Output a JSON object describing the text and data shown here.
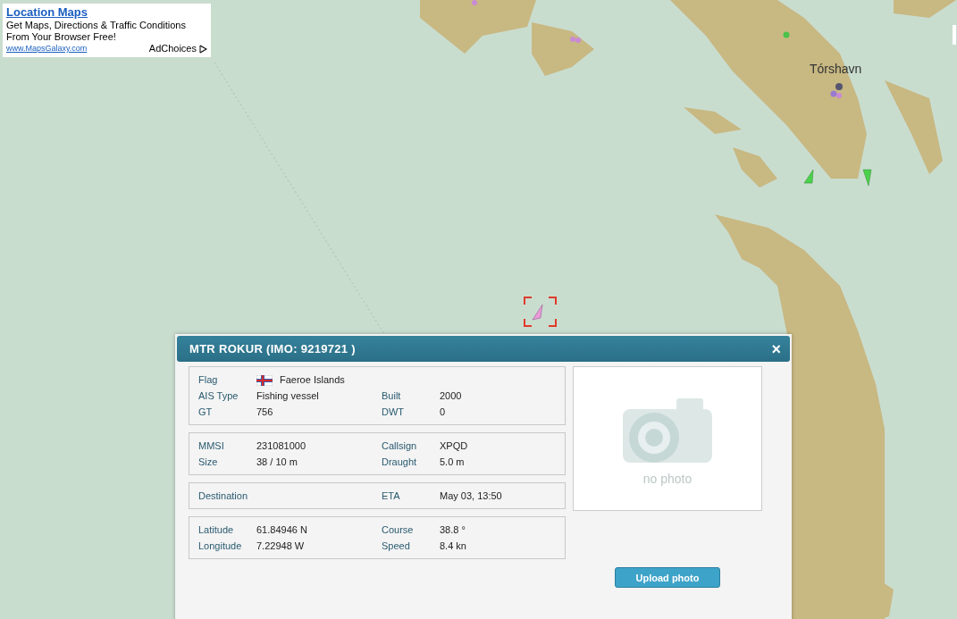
{
  "ad": {
    "title": "Location Maps",
    "lines": [
      "Get Maps, Directions & Traffic Conditions",
      "From Your Browser Free!"
    ],
    "url": "www.MapsGalaxy.com",
    "choices": "AdChoices"
  },
  "map": {
    "place_label": "Tórshavn"
  },
  "popup": {
    "title": "MTR ROKUR (IMO: 9219721 )",
    "close": "×",
    "sections": [
      {
        "rows": [
          {
            "fields": [
              {
                "label": "Flag",
                "value": "Faeroe Islands",
                "kind": "flag"
              }
            ]
          },
          {
            "fields": [
              {
                "label": "AIS Type",
                "value": "Fishing vessel"
              },
              {
                "label": "Built",
                "value": "2000"
              }
            ]
          },
          {
            "fields": [
              {
                "label": "GT",
                "value": "756"
              },
              {
                "label": "DWT",
                "value": "0"
              }
            ]
          }
        ]
      },
      {
        "rows": [
          {
            "fields": [
              {
                "label": "MMSI",
                "value": "231081000"
              },
              {
                "label": "Callsign",
                "value": "XPQD"
              }
            ]
          },
          {
            "fields": [
              {
                "label": "Size",
                "value": "38 / 10 m"
              },
              {
                "label": "Draught",
                "value": "5.0 m"
              }
            ]
          }
        ]
      },
      {
        "rows": [
          {
            "fields": [
              {
                "label": "Destination"
              },
              {
                "label": "ETA",
                "value": "May 03, 13:50"
              }
            ]
          }
        ]
      },
      {
        "rows": [
          {
            "fields": [
              {
                "label": "Latitude",
                "value": "61.84946 N"
              },
              {
                "label": "Course",
                "value": "38.8 °"
              }
            ]
          },
          {
            "fields": [
              {
                "label": "Longitude",
                "value": "7.22948 W"
              },
              {
                "label": "Speed",
                "value": "8.4 kn"
              }
            ]
          }
        ]
      }
    ],
    "photo_text": "no photo",
    "upload_button": "Upload photo"
  }
}
